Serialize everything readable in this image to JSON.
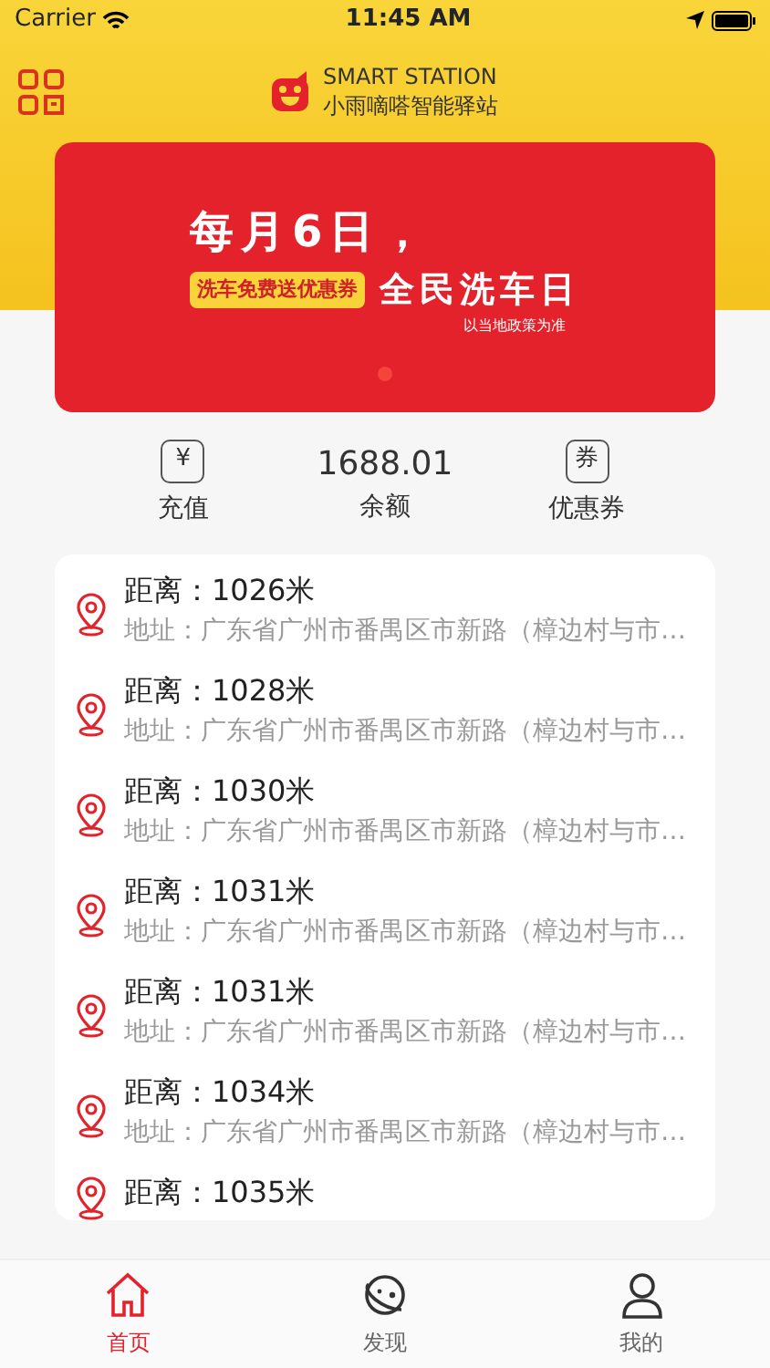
{
  "status_bar": {
    "carrier": "Carrier",
    "time": "11:45 AM"
  },
  "header": {
    "title_en": "SMART STATION",
    "title_cn": "小雨嘀嗒智能驿站"
  },
  "banner": {
    "headline": "每月6日，",
    "tag": "洗车免费送优惠券",
    "slogan": "全民洗车日",
    "note": "以当地政策为准",
    "pages": [
      {
        "selected": true
      }
    ]
  },
  "stats": [
    {
      "kind": "recharge",
      "icon": "¥",
      "label": "充值"
    },
    {
      "kind": "balance",
      "value": "1688.01",
      "label": "余额"
    },
    {
      "kind": "coupon",
      "icon": "券",
      "label": "优惠券"
    }
  ],
  "stations": [
    {
      "distance": "距离：1026米",
      "address": "地址：广东省广州市番禺区市新路（樟边村与市…"
    },
    {
      "distance": "距离：1028米",
      "address": "地址：广东省广州市番禺区市新路（樟边村与市…"
    },
    {
      "distance": "距离：1030米",
      "address": "地址：广东省广州市番禺区市新路（樟边村与市…"
    },
    {
      "distance": "距离：1031米",
      "address": "地址：广东省广州市番禺区市新路（樟边村与市…"
    },
    {
      "distance": "距离：1031米",
      "address": "地址：广东省广州市番禺区市新路（樟边村与市…"
    },
    {
      "distance": "距离：1034米",
      "address": "地址：广东省广州市番禺区市新路（樟边村与市…"
    },
    {
      "distance": "距离：1035米"
    }
  ],
  "tab_bar": [
    {
      "kind": "home",
      "label": "首页",
      "selected": true
    },
    {
      "kind": "discover",
      "label": "发现",
      "selected": false
    },
    {
      "kind": "mine",
      "label": "我的",
      "selected": false
    }
  ]
}
